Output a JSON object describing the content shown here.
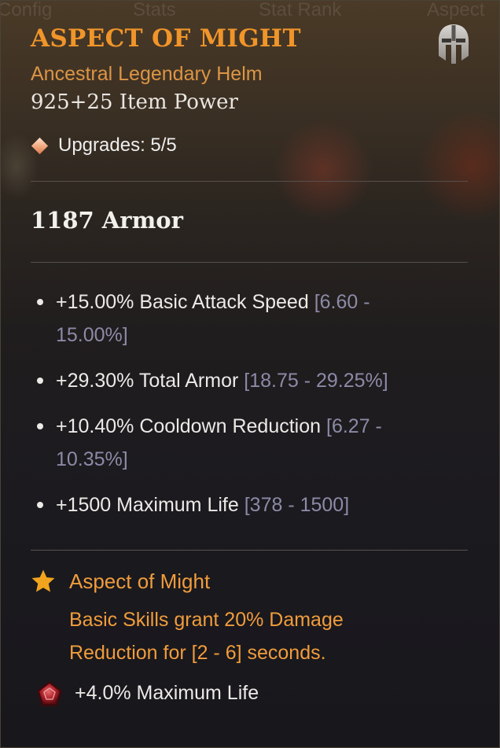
{
  "background_tabs": [
    "Config",
    "Stats",
    "Stat Rank",
    "Aspect"
  ],
  "item": {
    "title": "ASPECT OF MIGHT",
    "subtitle": "Ancestral Legendary Helm",
    "item_power": "925+25 Item Power",
    "upgrades": "Upgrades: 5/5",
    "armor": "1187 Armor"
  },
  "affixes": [
    {
      "text": "+15.00% Basic Attack Speed",
      "range": "[6.60 - 15.00%]"
    },
    {
      "text": "+29.30% Total Armor",
      "range": "[18.75 - 29.25%]"
    },
    {
      "text": "+10.40% Cooldown Reduction",
      "range": "[6.27 - 10.35%]"
    },
    {
      "text": "+1500 Maximum Life",
      "range": "[378 - 1500]"
    }
  ],
  "aspect": {
    "name": "Aspect of Might",
    "description": "Basic Skills grant 20% Damage Reduction for [2 - 6] seconds."
  },
  "socket": {
    "text": "+4.0% Maximum Life"
  },
  "icons": {
    "helm": "helm-icon",
    "upgrade": "diamond-icon",
    "aspect": "star-icon",
    "socket": "ruby-gem-icon"
  },
  "colors": {
    "title": "#f0952a",
    "subtitle": "#dc9545",
    "aspect_text": "#f09c3c",
    "range_text": "#8c8aa6",
    "body_text": "#eceae6"
  }
}
